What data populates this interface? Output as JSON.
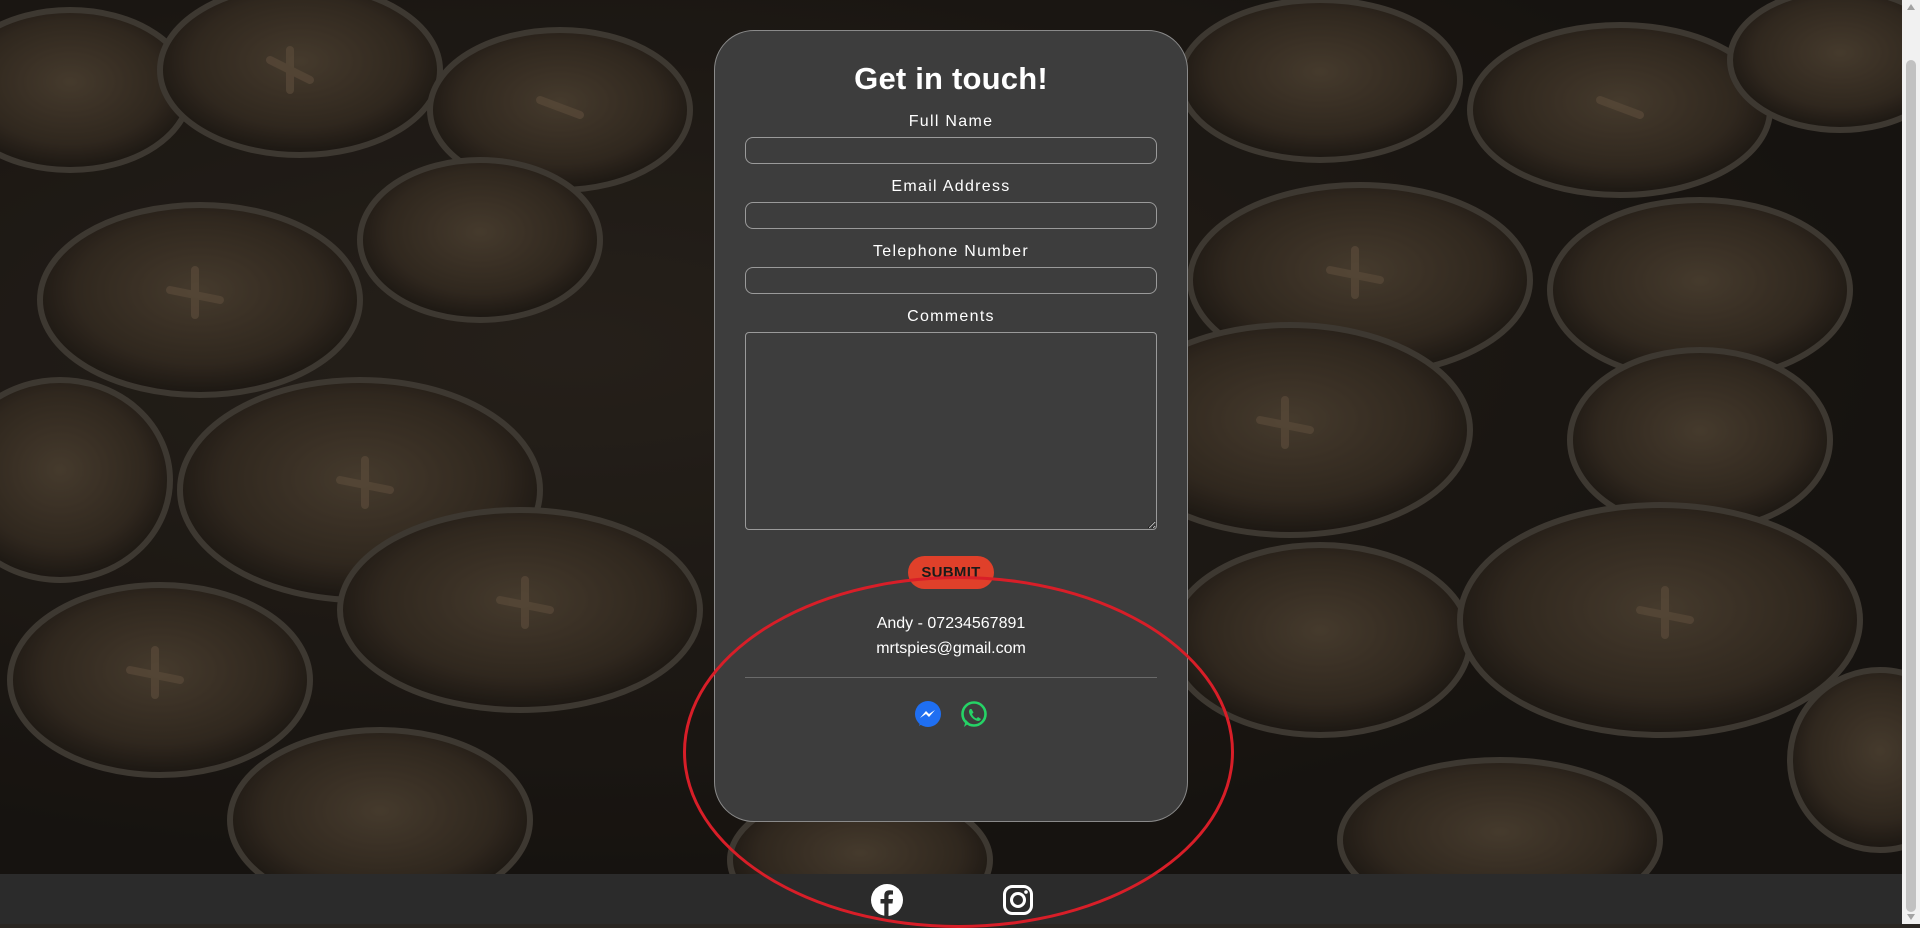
{
  "form": {
    "title": "Get in touch!",
    "fields": [
      {
        "label": "Full Name",
        "value": "",
        "placeholder": ""
      },
      {
        "label": "Email Address",
        "value": "",
        "placeholder": ""
      },
      {
        "label": "Telephone Number",
        "value": "",
        "placeholder": ""
      },
      {
        "label": "Comments",
        "value": "",
        "placeholder": ""
      }
    ],
    "submit_label": "SUBMIT"
  },
  "contact": {
    "phone_line": "Andy - 07234567891",
    "email": "mrtspies@gmail.com"
  },
  "card_social_icons": [
    "messenger-icon",
    "whatsapp-icon"
  ],
  "footer_social_icons": [
    "facebook-icon",
    "instagram-icon"
  ],
  "colors": {
    "card_bg": "#3d3d3d",
    "submit_bg": "#e0402a",
    "messenger": "#1f6ff2",
    "whatsapp": "#25d366",
    "highlight_ellipse": "#d81e28",
    "footer_bg": "#2b2b2b"
  }
}
